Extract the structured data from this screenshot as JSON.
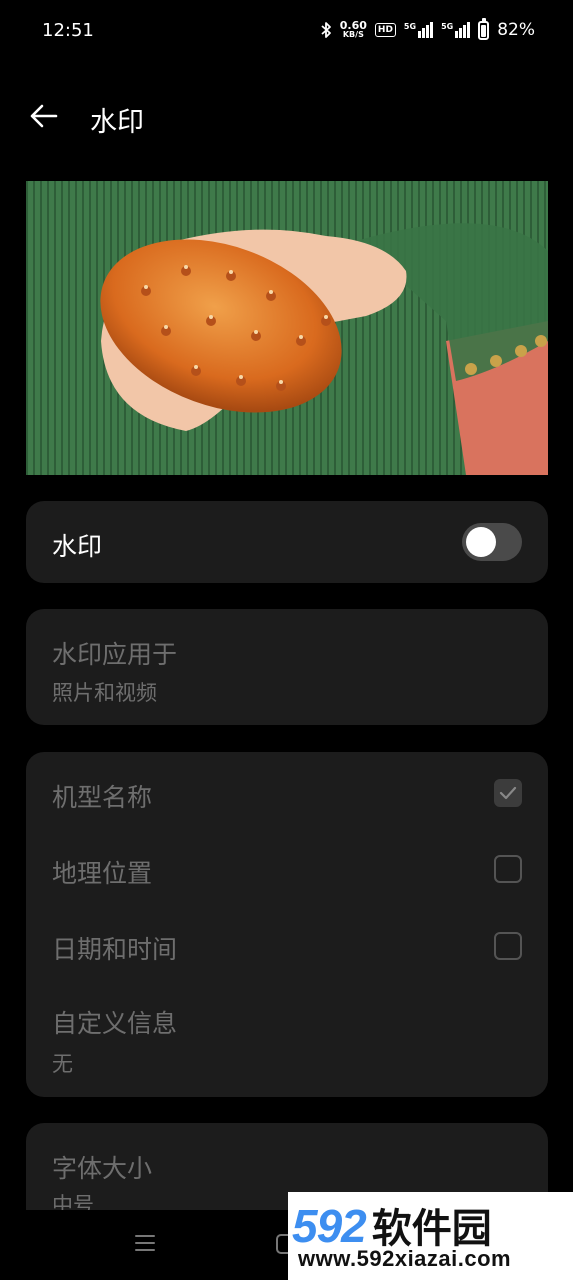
{
  "status_bar": {
    "time": "12:51",
    "net_speed": "0.60",
    "net_unit": "KB/S",
    "hd_label": "HD",
    "sim1_label": "5G",
    "sim2_label": "5G",
    "battery_percent": "82%",
    "battery_level": 0.82,
    "icons": [
      "bluetooth-icon",
      "hd-icon",
      "signal-icon",
      "signal-icon",
      "battery-icon"
    ]
  },
  "header": {
    "back_icon": "arrow-left-icon",
    "title": "水印"
  },
  "preview": {
    "icon": "photo-preview"
  },
  "watermark_toggle": {
    "label": "水印",
    "enabled": false
  },
  "apply_to": {
    "label": "水印应用于",
    "value": "照片和视频"
  },
  "options": [
    {
      "label": "机型名称",
      "checked": true
    },
    {
      "label": "地理位置",
      "checked": false
    },
    {
      "label": "日期和时间",
      "checked": false
    }
  ],
  "custom_info": {
    "label": "自定义信息",
    "value": "无"
  },
  "font_size": {
    "label": "字体大小",
    "value": "中号"
  },
  "navbar": {
    "icons": [
      "menu-icon",
      "home-icon"
    ]
  },
  "site_watermark": {
    "number": "592",
    "name": "软件园",
    "url": "www.592xiazai.com"
  },
  "colors": {
    "background": "#000000",
    "card": "#1c1c1c",
    "disabled_text": "#6e6e6e",
    "watermark_blue": "#3d8ef0"
  }
}
